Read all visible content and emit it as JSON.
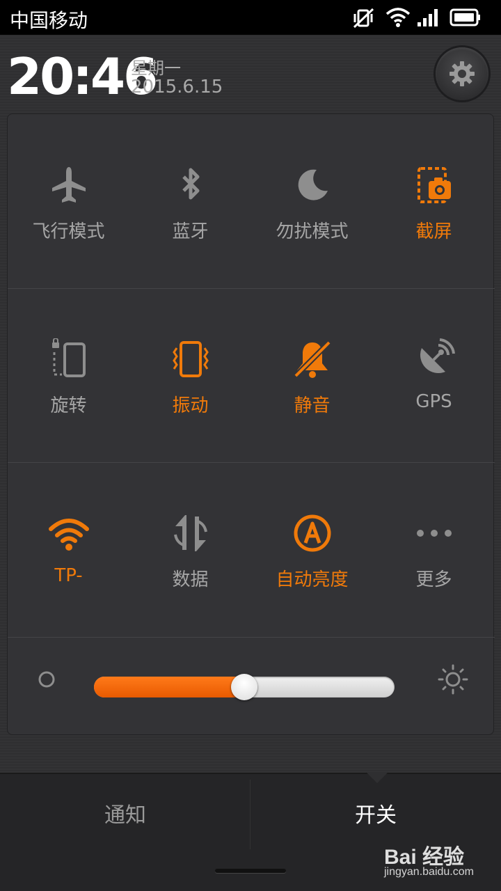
{
  "status_bar": {
    "carrier": "中国移动",
    "icons": [
      "mute-vibrate-icon",
      "wifi-icon",
      "signal-icon",
      "battery-icon"
    ]
  },
  "header": {
    "time": "20:46",
    "weekday": "星期一",
    "date": "2015.6.15",
    "settings_icon": "gear-icon"
  },
  "toggles": [
    {
      "label": "飞行模式",
      "icon": "airplane-icon",
      "active": false
    },
    {
      "label": "蓝牙",
      "icon": "bluetooth-icon",
      "active": false
    },
    {
      "label": "勿扰模式",
      "icon": "moon-icon",
      "active": false
    },
    {
      "label": "截屏",
      "icon": "screenshot-icon",
      "active": true
    },
    {
      "label": "旋转",
      "icon": "rotate-lock-icon",
      "active": false
    },
    {
      "label": "振动",
      "icon": "vibrate-icon",
      "active": true
    },
    {
      "label": "静音",
      "icon": "mute-bell-icon",
      "active": true
    },
    {
      "label": "GPS",
      "icon": "gps-icon",
      "active": false
    },
    {
      "label": "TP-",
      "icon": "wifi-icon",
      "active": true
    },
    {
      "label": "数据",
      "icon": "data-icon",
      "active": false
    },
    {
      "label": "自动亮度",
      "icon": "auto-brightness-icon",
      "active": true
    },
    {
      "label": "更多",
      "icon": "more-icon",
      "active": false
    }
  ],
  "brightness": {
    "level": 0.5,
    "min_icon": "dim-icon",
    "max_icon": "sun-icon"
  },
  "tabs": {
    "notifications": "通知",
    "switches": "开关",
    "selected": "switches"
  },
  "watermark": {
    "main": "Bai 经验",
    "sub": "jingyan.baidu.com"
  },
  "colors": {
    "accent": "#f07a0a",
    "inactive": "#a6a6a6",
    "background": "#2f2f31"
  }
}
